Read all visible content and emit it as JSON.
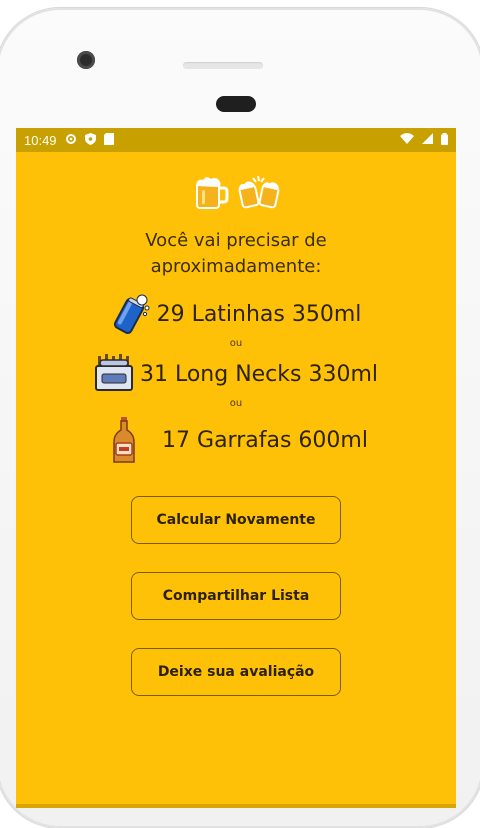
{
  "status_bar": {
    "time": "10:49"
  },
  "header": {
    "subtitle": "Você vai precisar de aproximadamente:"
  },
  "results": [
    {
      "label": "29 Latinhas 350ml",
      "icon": "beer-can-icon"
    },
    {
      "separator": "ou"
    },
    {
      "label": "31 Long Necks 330ml",
      "icon": "six-pack-icon"
    },
    {
      "separator": "ou"
    },
    {
      "label": "17 Garrafas 600ml",
      "icon": "beer-bottle-icon"
    }
  ],
  "buttons": {
    "recalc": "Calcular Novamente",
    "share": "Compartilhar Lista",
    "review": "Deixe sua avaliação"
  },
  "colors": {
    "background": "#FFC107",
    "statusbar": "#C8A000"
  }
}
